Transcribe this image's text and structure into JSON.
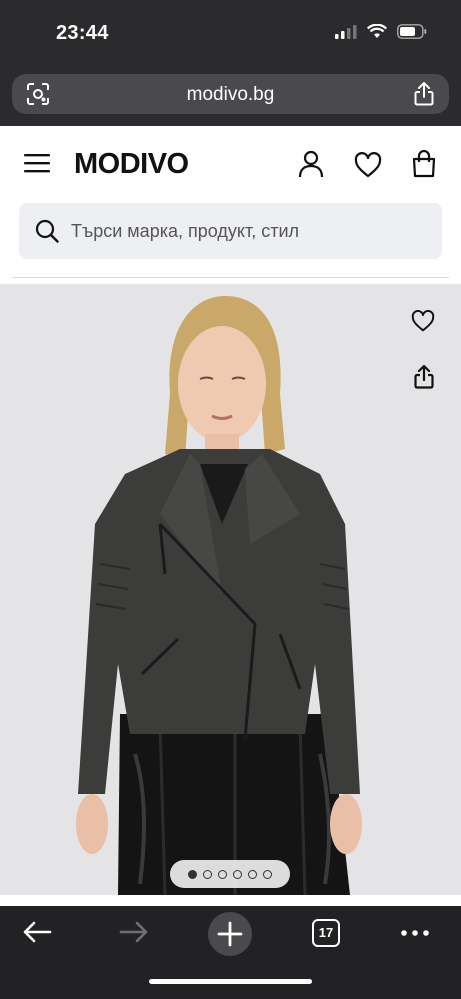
{
  "status_bar": {
    "time": "23:44"
  },
  "browser": {
    "url": "modivo.bg",
    "tab_count": "17"
  },
  "site": {
    "logo": "MODIVO",
    "search_placeholder": "Търси марка, продукт, стил"
  },
  "gallery": {
    "image_count": 6,
    "active_index": 0
  },
  "colors": {
    "accent": "#111111",
    "page_bg": "#ffffff",
    "browser_bg": "#222224"
  },
  "icons": [
    "qr-lens-icon",
    "share-icon",
    "menu-icon",
    "account-icon",
    "heart-icon",
    "bag-icon",
    "search-icon",
    "back-icon",
    "forward-icon",
    "plus-icon",
    "tabs-icon",
    "more-icon"
  ]
}
